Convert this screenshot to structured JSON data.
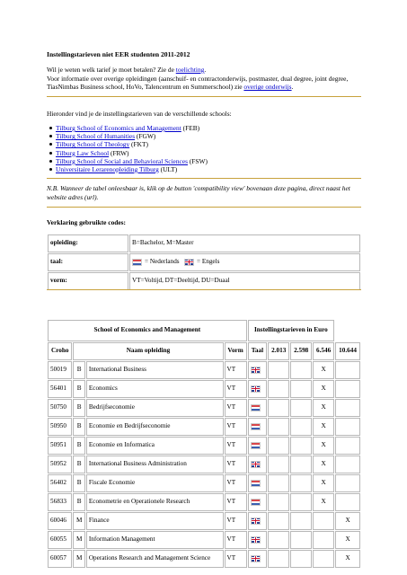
{
  "title": "Instellingstarieven niet EER studenten 2011-2012",
  "intro": {
    "line1_a": "Wil je weten welk tarief je moet betalen? Zie de ",
    "line1_link": "toelichting",
    "line1_b": ".",
    "line2_a": "Voor informatie over overige opleidingen (aanschuif- en contractonderwijs, postmaster, dual degree, joint degree, TiasNimbas Business school, HoVo, Talencentrum en Summerschool) zie ",
    "line2_link": "overige onderwijs",
    "line2_b": "."
  },
  "schools_intro": "Hieronder vind je de instellingstarieven van de verschillende schools:",
  "schools": [
    {
      "link": "Tilburg School of Economics and Management",
      "abbr": " (FEB)"
    },
    {
      "link": "Tilburg School of Humanities",
      "abbr": " (FGW)"
    },
    {
      "link": "Tilburg School of Theology",
      "abbr": " (FKT)"
    },
    {
      "link": "Tilburg Law School",
      "abbr": " (FRW)"
    },
    {
      "link": "Tilburg School of Social and Behavioral Sciences",
      "abbr": " (FSW)"
    },
    {
      "link": "Universitaire Lerarenopleiding Tilburg",
      "abbr": " (ULT)"
    }
  ],
  "nb": "N.B. Wanneer de tabel onleesbaar is, klik op de button 'compatibility view' bovenaan deze pagina, direct naast het website adres (url).",
  "verklaring": "Verklaring gebruikte codes:",
  "codes": {
    "opleiding_label": "opleiding:",
    "opleiding_value": "B=Bachelor, M=Master",
    "taal_label": "taal:",
    "taal_nl": "= Nederlands",
    "taal_en": "= Engels",
    "vorm_label": "vorm:",
    "vorm_value": "VT=Voltijd, DT=Deeltijd, DU=Duaal"
  },
  "table": {
    "school": "School of Economics and Management",
    "tarieven": "Instellingstarieven in Euro",
    "headers": [
      "Croho",
      "Naam opleiding",
      "Vorm",
      "Taal",
      "2.013",
      "2.598",
      "6.546",
      "10.644"
    ],
    "rows": [
      {
        "croho": "50019",
        "lvl": "B",
        "naam": "International Business",
        "vorm": "VT",
        "taal": "en",
        "t1": "",
        "t2": "",
        "t3": "X",
        "t4": ""
      },
      {
        "croho": "56401",
        "lvl": "B",
        "naam": "Economics",
        "vorm": "VT",
        "taal": "en",
        "t1": "",
        "t2": "",
        "t3": "X",
        "t4": ""
      },
      {
        "croho": "50750",
        "lvl": "B",
        "naam": "Bedrijfseconomie",
        "vorm": "VT",
        "taal": "nl",
        "t1": "",
        "t2": "",
        "t3": "X",
        "t4": ""
      },
      {
        "croho": "50950",
        "lvl": "B",
        "naam": "Economie en Bedrijfseconomie",
        "vorm": "VT",
        "taal": "nl",
        "t1": "",
        "t2": "",
        "t3": "X",
        "t4": ""
      },
      {
        "croho": "50951",
        "lvl": "B",
        "naam": "Economie en Informatica",
        "vorm": "VT",
        "taal": "nl",
        "t1": "",
        "t2": "",
        "t3": "X",
        "t4": ""
      },
      {
        "croho": "50952",
        "lvl": "B",
        "naam": "International Business Administration",
        "vorm": "VT",
        "taal": "en",
        "t1": "",
        "t2": "",
        "t3": "X",
        "t4": ""
      },
      {
        "croho": "56402",
        "lvl": "B",
        "naam": "Fiscale Economie",
        "vorm": "VT",
        "taal": "nl",
        "t1": "",
        "t2": "",
        "t3": "X",
        "t4": ""
      },
      {
        "croho": "56833",
        "lvl": "B",
        "naam": "Econometrie en Operationele Research",
        "vorm": "VT",
        "taal": "nl",
        "t1": "",
        "t2": "",
        "t3": "X",
        "t4": ""
      },
      {
        "croho": "60046",
        "lvl": "M",
        "naam": "Finance",
        "vorm": "VT",
        "taal": "en",
        "t1": "",
        "t2": "",
        "t3": "",
        "t4": "X"
      },
      {
        "croho": "60055",
        "lvl": "M",
        "naam": "Information Management",
        "vorm": "VT",
        "taal": "en",
        "t1": "",
        "t2": "",
        "t3": "",
        "t4": "X"
      },
      {
        "croho": "60057",
        "lvl": "M",
        "naam": "Operations Research and Management Science",
        "vorm": "VT",
        "taal": "en",
        "t1": "",
        "t2": "",
        "t3": "",
        "t4": "X"
      }
    ]
  },
  "colors": {
    "link": "#0000cc",
    "rule": "#c8a23c",
    "nl_flag": "nl-flag-icon",
    "en_flag": "en-flag-icon"
  }
}
